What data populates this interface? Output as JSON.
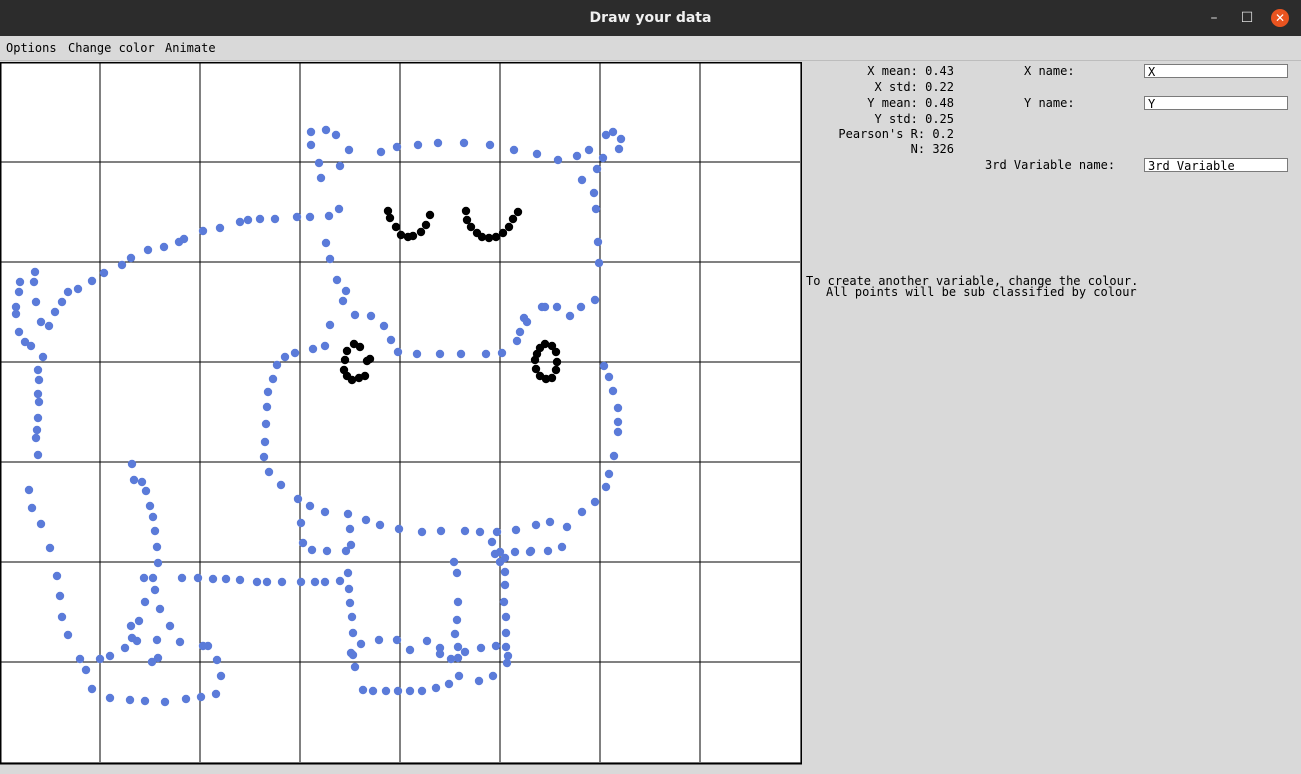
{
  "window": {
    "title": "Draw your data",
    "minimize_glyph": "–",
    "maximize_glyph": "☐",
    "close_glyph": "✕"
  },
  "menu": {
    "options": "Options",
    "change_color": "Change color",
    "animate": "Animate"
  },
  "stats": {
    "x_mean": "X mean: 0.43",
    "x_std": "X std: 0.22",
    "y_mean": "Y mean: 0.48",
    "y_std": "Y std: 0.25",
    "pearson": "Pearson's R: 0.2",
    "n": "N: 326"
  },
  "fields": {
    "x_name_label": "X name:",
    "x_name_value": "X",
    "y_name_label": "Y name:",
    "y_name_value": "Y",
    "third_label": "3rd Variable name:",
    "third_value": "3rd Variable"
  },
  "hint": {
    "line1": "To create another variable, change the colour.",
    "line2": "All points will be sub classified by colour"
  },
  "colors": {
    "blue_points": "#5b7bd9",
    "black_points": "#000000"
  },
  "chart_data": {
    "type": "scatter",
    "xlim": [
      0,
      8
    ],
    "ylim": [
      0,
      7
    ],
    "grid": true,
    "series": [
      {
        "color": "#5b7bd9",
        "points": [
          [
            3.11,
            6.3
          ],
          [
            3.26,
            6.32
          ],
          [
            3.36,
            6.27
          ],
          [
            3.49,
            6.12
          ],
          [
            3.81,
            6.1
          ],
          [
            3.97,
            6.15
          ],
          [
            4.18,
            6.17
          ],
          [
            4.38,
            6.19
          ],
          [
            4.64,
            6.19
          ],
          [
            4.9,
            6.17
          ],
          [
            5.14,
            6.12
          ],
          [
            5.37,
            6.08
          ],
          [
            5.58,
            6.02
          ],
          [
            5.77,
            6.06
          ],
          [
            5.89,
            6.12
          ],
          [
            6.06,
            6.27
          ],
          [
            6.13,
            6.3
          ],
          [
            6.21,
            6.23
          ],
          [
            6.19,
            6.13
          ],
          [
            6.03,
            6.04
          ],
          [
            5.97,
            5.93
          ],
          [
            5.82,
            5.82
          ],
          [
            5.94,
            5.69
          ],
          [
            5.96,
            5.53
          ],
          [
            5.98,
            5.2
          ],
          [
            5.99,
            4.99
          ],
          [
            5.95,
            4.62
          ],
          [
            5.81,
            4.55
          ],
          [
            5.7,
            4.46
          ],
          [
            5.57,
            4.55
          ],
          [
            5.42,
            4.55
          ],
          [
            5.24,
            4.44
          ],
          [
            5.17,
            4.21
          ],
          [
            5.02,
            4.09
          ],
          [
            4.86,
            4.08
          ],
          [
            4.61,
            4.08
          ],
          [
            4.4,
            4.08
          ],
          [
            4.17,
            4.08
          ],
          [
            3.98,
            4.1
          ],
          [
            3.91,
            4.22
          ],
          [
            3.84,
            4.36
          ],
          [
            3.71,
            4.46
          ],
          [
            3.55,
            4.47
          ],
          [
            3.43,
            4.61
          ],
          [
            3.3,
            4.37
          ],
          [
            3.46,
            4.71
          ],
          [
            3.37,
            4.82
          ],
          [
            3.3,
            5.03
          ],
          [
            3.26,
            5.19
          ],
          [
            3.29,
            5.46
          ],
          [
            3.39,
            5.53
          ],
          [
            3.21,
            5.84
          ],
          [
            3.19,
            5.99
          ],
          [
            3.11,
            6.17
          ],
          [
            3.4,
            5.96
          ],
          [
            3.1,
            5.45
          ],
          [
            2.97,
            5.45
          ],
          [
            2.75,
            5.43
          ],
          [
            2.6,
            5.43
          ],
          [
            2.48,
            5.42
          ],
          [
            2.4,
            5.4
          ],
          [
            2.2,
            5.34
          ],
          [
            2.03,
            5.31
          ],
          [
            1.84,
            5.23
          ],
          [
            1.79,
            5.2
          ],
          [
            1.64,
            5.15
          ],
          [
            1.48,
            5.12
          ],
          [
            1.31,
            5.04
          ],
          [
            1.22,
            4.97
          ],
          [
            1.04,
            4.89
          ],
          [
            0.92,
            4.81
          ],
          [
            0.78,
            4.73
          ],
          [
            0.68,
            4.7
          ],
          [
            0.62,
            4.6
          ],
          [
            0.55,
            4.5
          ],
          [
            0.49,
            4.36
          ],
          [
            0.41,
            4.4
          ],
          [
            0.36,
            4.6
          ],
          [
            0.34,
            4.8
          ],
          [
            0.35,
            4.9
          ],
          [
            0.2,
            4.8
          ],
          [
            0.19,
            4.7
          ],
          [
            0.16,
            4.55
          ],
          [
            0.16,
            4.48
          ],
          [
            0.19,
            4.3
          ],
          [
            0.25,
            4.2
          ],
          [
            0.31,
            4.16
          ],
          [
            0.43,
            4.05
          ],
          [
            0.38,
            3.92
          ],
          [
            0.39,
            3.82
          ],
          [
            0.38,
            3.68
          ],
          [
            0.39,
            3.6
          ],
          [
            0.38,
            3.44
          ],
          [
            0.37,
            3.32
          ],
          [
            0.36,
            3.24
          ],
          [
            0.38,
            3.07
          ],
          [
            0.29,
            2.72
          ],
          [
            0.32,
            2.54
          ],
          [
            0.41,
            2.38
          ],
          [
            0.5,
            2.14
          ],
          [
            0.57,
            1.86
          ],
          [
            0.6,
            1.66
          ],
          [
            0.62,
            1.45
          ],
          [
            0.68,
            1.27
          ],
          [
            0.8,
            1.03
          ],
          [
            0.86,
            0.92
          ],
          [
            0.92,
            0.73
          ],
          [
            1.1,
            0.64
          ],
          [
            1.3,
            0.62
          ],
          [
            1.45,
            0.61
          ],
          [
            1.65,
            0.6
          ],
          [
            1.86,
            0.63
          ],
          [
            2.01,
            0.65
          ],
          [
            2.16,
            0.68
          ],
          [
            2.21,
            0.86
          ],
          [
            2.17,
            1.02
          ],
          [
            2.08,
            1.16
          ],
          [
            2.03,
            1.16
          ],
          [
            1.8,
            1.2
          ],
          [
            1.7,
            1.36
          ],
          [
            1.6,
            1.53
          ],
          [
            1.55,
            1.72
          ],
          [
            1.53,
            1.84
          ],
          [
            1.44,
            1.84
          ],
          [
            1.45,
            1.6
          ],
          [
            1.39,
            1.41
          ],
          [
            1.37,
            1.21
          ],
          [
            1.25,
            1.14
          ],
          [
            1.1,
            1.06
          ],
          [
            1.0,
            1.03
          ],
          [
            1.32,
            1.24
          ],
          [
            1.31,
            1.36
          ],
          [
            1.58,
            1.04
          ],
          [
            1.57,
            1.22
          ],
          [
            1.52,
            1.0
          ],
          [
            1.58,
            1.99
          ],
          [
            1.57,
            2.15
          ],
          [
            1.55,
            2.31
          ],
          [
            1.53,
            2.45
          ],
          [
            1.5,
            2.56
          ],
          [
            1.46,
            2.71
          ],
          [
            1.42,
            2.8
          ],
          [
            1.34,
            2.82
          ],
          [
            1.32,
            2.98
          ],
          [
            1.82,
            1.84
          ],
          [
            1.98,
            1.84
          ],
          [
            2.13,
            1.83
          ],
          [
            2.26,
            1.83
          ],
          [
            2.4,
            1.82
          ],
          [
            2.57,
            1.8
          ],
          [
            2.67,
            1.8
          ],
          [
            2.82,
            1.8
          ],
          [
            3.01,
            1.8
          ],
          [
            3.15,
            1.8
          ],
          [
            3.25,
            1.8
          ],
          [
            3.4,
            1.81
          ],
          [
            3.48,
            1.89
          ],
          [
            3.49,
            1.73
          ],
          [
            3.5,
            1.59
          ],
          [
            3.52,
            1.45
          ],
          [
            3.53,
            1.29
          ],
          [
            3.51,
            1.09
          ],
          [
            3.55,
            0.95
          ],
          [
            3.63,
            0.72
          ],
          [
            3.73,
            0.71
          ],
          [
            3.86,
            0.71
          ],
          [
            3.98,
            0.71
          ],
          [
            4.1,
            0.71
          ],
          [
            4.22,
            0.71
          ],
          [
            4.36,
            0.74
          ],
          [
            4.49,
            0.78
          ],
          [
            4.59,
            0.86
          ],
          [
            4.58,
            1.04
          ],
          [
            4.58,
            1.15
          ],
          [
            4.55,
            1.28
          ],
          [
            4.57,
            1.42
          ],
          [
            4.58,
            1.6
          ],
          [
            4.57,
            1.89
          ],
          [
            4.54,
            2.0
          ],
          [
            3.53,
            1.07
          ],
          [
            3.61,
            1.18
          ],
          [
            3.79,
            1.22
          ],
          [
            3.97,
            1.22
          ],
          [
            4.1,
            1.12
          ],
          [
            4.27,
            1.21
          ],
          [
            4.4,
            1.14
          ],
          [
            4.4,
            1.08
          ],
          [
            4.51,
            1.03
          ],
          [
            4.65,
            1.1
          ],
          [
            4.81,
            1.14
          ],
          [
            4.96,
            1.16
          ],
          [
            5.08,
            1.06
          ],
          [
            5.07,
            0.99
          ],
          [
            4.93,
            0.86
          ],
          [
            4.79,
            0.81
          ],
          [
            5.06,
            1.15
          ],
          [
            5.06,
            1.29
          ],
          [
            5.06,
            1.45
          ],
          [
            5.04,
            1.6
          ],
          [
            5.05,
            1.77
          ],
          [
            5.05,
            1.9
          ],
          [
            5.05,
            2.04
          ],
          [
            5.0,
            2.1
          ],
          [
            5.15,
            2.1
          ],
          [
            5.31,
            2.11
          ],
          [
            5.48,
            2.11
          ],
          [
            5.62,
            2.15
          ],
          [
            5.67,
            2.35
          ],
          [
            5.82,
            2.5
          ],
          [
            5.95,
            2.6
          ],
          [
            6.06,
            2.75
          ],
          [
            6.09,
            2.88
          ],
          [
            6.14,
            3.06
          ],
          [
            6.18,
            3.3
          ],
          [
            6.18,
            3.4
          ],
          [
            6.18,
            3.54
          ],
          [
            6.13,
            3.71
          ],
          [
            6.09,
            3.85
          ],
          [
            6.04,
            3.96
          ],
          [
            5.5,
            2.4
          ],
          [
            5.36,
            2.37
          ],
          [
            5.16,
            2.32
          ],
          [
            4.97,
            2.3
          ],
          [
            4.8,
            2.3
          ],
          [
            4.65,
            2.31
          ],
          [
            4.41,
            2.31
          ],
          [
            4.22,
            2.3
          ],
          [
            3.99,
            2.33
          ],
          [
            3.8,
            2.37
          ],
          [
            3.66,
            2.42
          ],
          [
            3.48,
            2.48
          ],
          [
            3.25,
            2.5
          ],
          [
            3.1,
            2.56
          ],
          [
            2.98,
            2.63
          ],
          [
            3.01,
            2.39
          ],
          [
            3.03,
            2.19
          ],
          [
            3.12,
            2.12
          ],
          [
            3.27,
            2.11
          ],
          [
            3.46,
            2.11
          ],
          [
            2.81,
            2.77
          ],
          [
            2.69,
            2.9
          ],
          [
            2.64,
            3.05
          ],
          [
            2.65,
            3.2
          ],
          [
            2.66,
            3.38
          ],
          [
            2.67,
            3.55
          ],
          [
            2.68,
            3.7
          ],
          [
            2.73,
            3.83
          ],
          [
            2.77,
            3.97
          ],
          [
            2.85,
            4.05
          ],
          [
            2.95,
            4.09
          ],
          [
            3.13,
            4.13
          ],
          [
            3.25,
            4.16
          ],
          [
            3.5,
            2.33
          ],
          [
            3.51,
            2.17
          ],
          [
            4.92,
            2.2
          ],
          [
            4.95,
            2.08
          ],
          [
            5.0,
            2.0
          ],
          [
            5.3,
            2.1
          ],
          [
            5.2,
            4.3
          ],
          [
            5.27,
            4.4
          ],
          [
            5.45,
            4.55
          ]
        ]
      },
      {
        "color": "#000000",
        "points": [
          [
            3.88,
            5.51
          ],
          [
            3.9,
            5.44
          ],
          [
            3.96,
            5.35
          ],
          [
            4.01,
            5.27
          ],
          [
            4.08,
            5.25
          ],
          [
            4.13,
            5.26
          ],
          [
            4.21,
            5.3
          ],
          [
            4.26,
            5.37
          ],
          [
            4.3,
            5.47
          ],
          [
            4.66,
            5.51
          ],
          [
            4.67,
            5.42
          ],
          [
            4.71,
            5.35
          ],
          [
            4.77,
            5.29
          ],
          [
            4.82,
            5.25
          ],
          [
            4.89,
            5.24
          ],
          [
            4.96,
            5.25
          ],
          [
            5.03,
            5.29
          ],
          [
            5.09,
            5.35
          ],
          [
            5.13,
            5.43
          ],
          [
            5.18,
            5.5
          ],
          [
            3.54,
            4.18
          ],
          [
            3.47,
            4.11
          ],
          [
            3.45,
            4.02
          ],
          [
            3.44,
            3.92
          ],
          [
            3.47,
            3.86
          ],
          [
            3.52,
            3.82
          ],
          [
            3.59,
            3.84
          ],
          [
            3.65,
            3.86
          ],
          [
            3.67,
            4.01
          ],
          [
            3.7,
            4.03
          ],
          [
            3.6,
            4.15
          ],
          [
            5.4,
            4.14
          ],
          [
            5.45,
            4.18
          ],
          [
            5.52,
            4.16
          ],
          [
            5.56,
            4.1
          ],
          [
            5.57,
            4.0
          ],
          [
            5.56,
            3.92
          ],
          [
            5.52,
            3.84
          ],
          [
            5.46,
            3.83
          ],
          [
            5.4,
            3.86
          ],
          [
            5.36,
            3.93
          ],
          [
            5.35,
            4.02
          ],
          [
            5.37,
            4.08
          ]
        ]
      }
    ]
  }
}
